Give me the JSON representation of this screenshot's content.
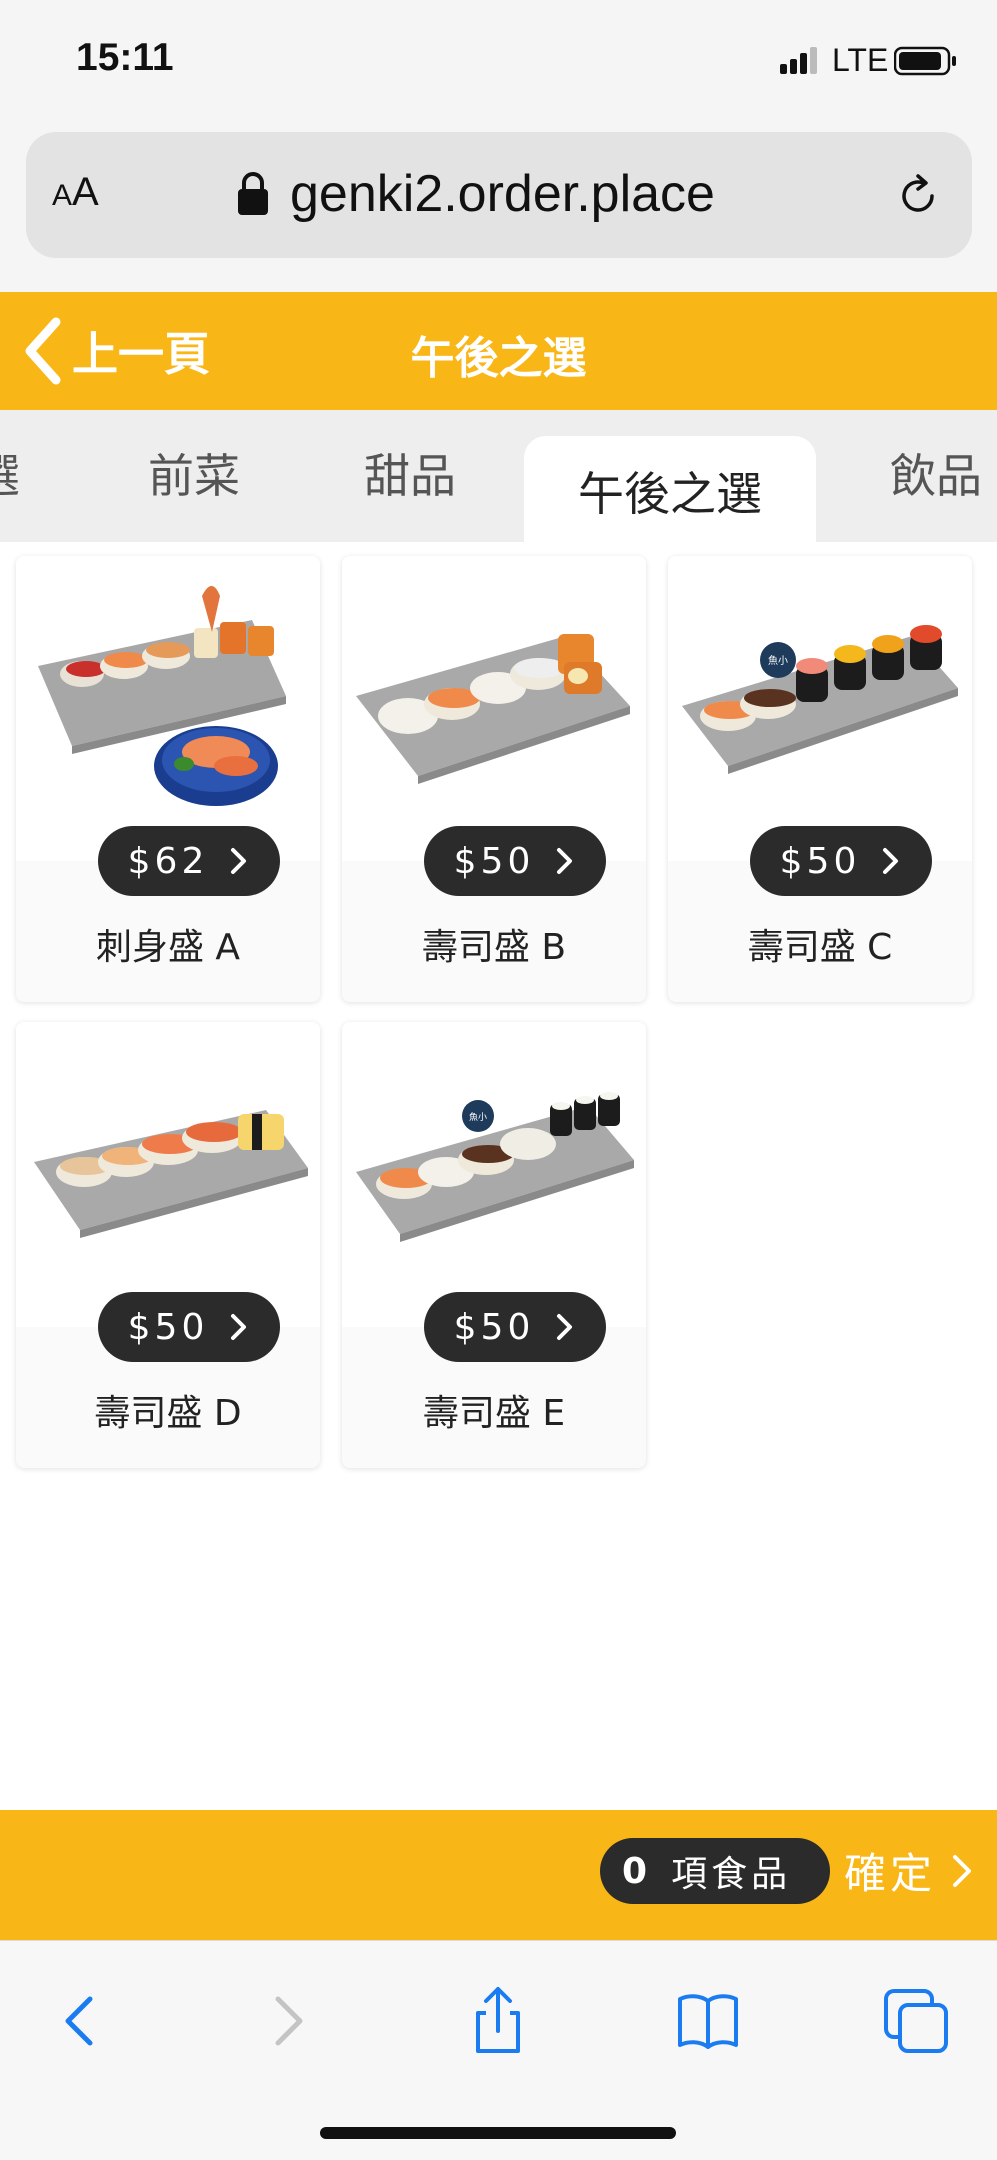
{
  "status": {
    "time": "15:11",
    "network": "LTE"
  },
  "browser": {
    "text_size_small": "A",
    "text_size_big": "A",
    "url": "genki2.order.place"
  },
  "header": {
    "back_label": "上一頁",
    "title": "午後之選"
  },
  "tabs": [
    {
      "label": "選"
    },
    {
      "label": "前菜"
    },
    {
      "label": "甜品"
    },
    {
      "label": "午後之選",
      "active": true
    },
    {
      "label": "飲品"
    }
  ],
  "items": [
    {
      "name": "刺身盛 A",
      "price": "$62"
    },
    {
      "name": "壽司盛 B",
      "price": "$50"
    },
    {
      "name": "壽司盛 C",
      "price": "$50"
    },
    {
      "name": "壽司盛 D",
      "price": "$50"
    },
    {
      "name": "壽司盛 E",
      "price": "$50"
    }
  ],
  "cart": {
    "count": "0",
    "label": "項食品",
    "confirm_label": "確定"
  },
  "icons": {
    "back": "chevron-left-icon",
    "lock": "lock-icon",
    "reload": "reload-icon",
    "share": "share-icon",
    "bookmarks": "book-icon",
    "tabs": "tabs-icon"
  },
  "colors": {
    "accent": "#f9b617",
    "pill": "#2b2b2b",
    "ios_blue": "#1a7cf0"
  }
}
